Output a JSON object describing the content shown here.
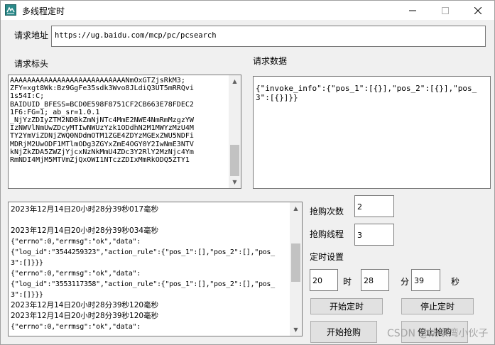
{
  "window": {
    "title": "多线程定时",
    "minimize_glyph": "—",
    "maximize_glyph": "☐",
    "close_glyph": "✕"
  },
  "labels": {
    "url": "请求地址",
    "headers": "请求标头",
    "data": "请求数据",
    "buy_count": "抢购次数",
    "threads": "抢购线程",
    "timer_settings": "定时设置",
    "hour": "时",
    "minute": "分",
    "second": "秒"
  },
  "url_value": "https://ug.baidu.com/mcp/pc/pcsearch",
  "headers_lines": [
    "AAAAAAAAAAAAAAAAAAAAAAAAAAANmOxGTZjsRkM3;",
    "ZFY=xgt8Wk:Bz9GgFe35sdk3Wvo8JLdiQ3UT5mRRQvi",
    "1s54I:C;",
    "BAIDUID_BFESS=BCD0E598F8751CF2CB663E78FDEC2",
    "1F6:FG=1; ab_sr=1.0.1",
    "_NjYzZDIyZTM2NDBkZmNjNTc4MmE2NWE4NmRmMzgzYW",
    "IzNWVlNmUwZDcyMTIwNWUzYzk1ODdhN2M1MWYzMzU4M",
    "TY2YmViZDNjZWQ0NDdmOTM1ZGE4ZDYzMGExZWU5NDFi",
    "MDRjM2UwODF1MTlmODg3ZGYxZmE4OGY0Y2IwNmE3NTV",
    "kNjZkZDA5ZWZjYjcxNzNkMmU4ZDc3Y2RlY2MzNjc4Ym",
    "RmNDI4MjM5MTVmZjQxOWI1NTczZDIxMmRkODQ5ZTY1"
  ],
  "request_data_lines": [
    "{\"invoke_info\":{\"pos_1\":[{}],\"pos_2\":[{}],\"pos_",
    "3\":[{}]}}"
  ],
  "log_lines": [
    {
      "text": "2023年12月14日20小时28分39秒017毫秒",
      "kind": "t"
    },
    {
      "text": "",
      "kind": "t"
    },
    {
      "text": "2023年12月14日20小时28分39秒034毫秒",
      "kind": "t"
    },
    {
      "text": "{\"errno\":0,\"errmsg\":\"ok\",\"data\":",
      "kind": "j"
    },
    {
      "text": "{\"log_id\":\"3544259323\",\"action_rule\":{\"pos_1\":[],\"pos_2\":[],\"pos_",
      "kind": "j"
    },
    {
      "text": "3\":[]}}}",
      "kind": "j"
    },
    {
      "text": "{\"errno\":0,\"errmsg\":\"ok\",\"data\":",
      "kind": "j"
    },
    {
      "text": "{\"log_id\":\"3553117358\",\"action_rule\":{\"pos_1\":[],\"pos_2\":[],\"pos_",
      "kind": "j"
    },
    {
      "text": "3\":[]}}}",
      "kind": "j"
    },
    {
      "text": "2023年12月14日20小时28分39秒120毫秒",
      "kind": "t"
    },
    {
      "text": "2023年12月14日20小时28分39秒120毫秒",
      "kind": "t"
    },
    {
      "text": "{\"errno\":0,\"errmsg\":\"ok\",\"data\":",
      "kind": "j"
    }
  ],
  "fields": {
    "buy_count": "2",
    "threads": "3",
    "hour": "20",
    "minute": "28",
    "second": "39"
  },
  "buttons": {
    "start_timer": "开始定时",
    "stop_timer": "停止定时",
    "start_buy": "开始抢购",
    "stop_buy": "停止抢购"
  },
  "watermark": "CSDN @姚家湾小伙子",
  "colors": {
    "window_bg": "#f0f0f0",
    "icon_teal": "#2b8a8a"
  }
}
